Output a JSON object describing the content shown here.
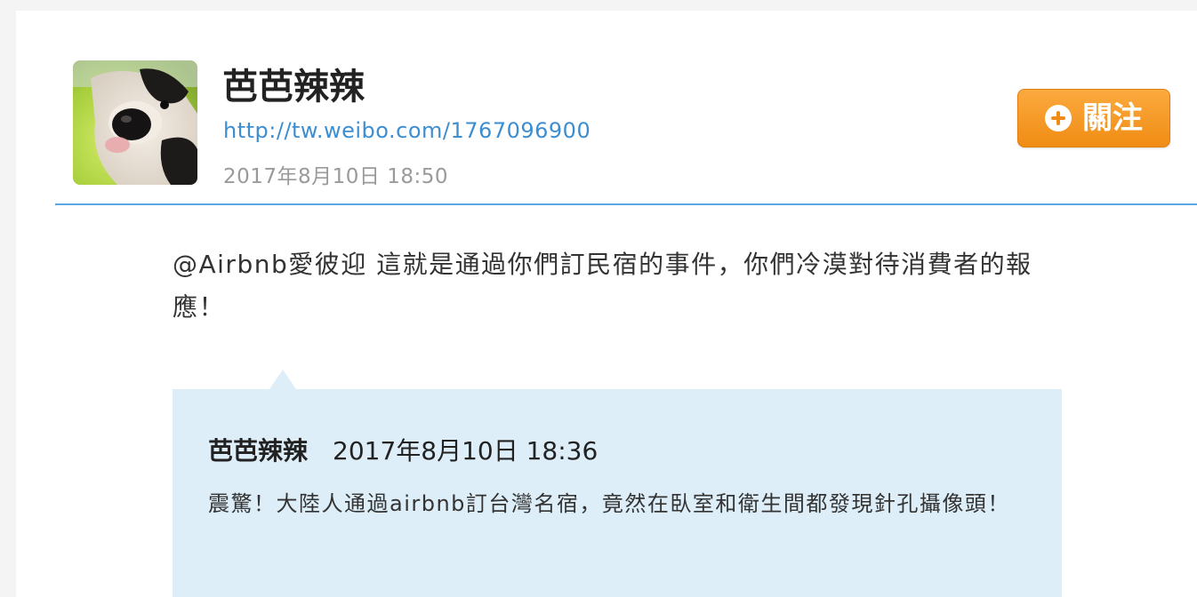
{
  "post": {
    "author": "芭芭辣辣",
    "profile_url": "http://tw.weibo.com/1767096900",
    "timestamp": "2017年8月10日 18:50",
    "text": "@Airbnb愛彼迎 這就是通過你們訂民宿的事件，你們冷漠對待消費者的報應！"
  },
  "follow_button": {
    "label": "關注",
    "icon": "plus-circle-icon"
  },
  "quoted_post": {
    "author": "芭芭辣辣",
    "timestamp": "2017年8月10日 18:36",
    "text": "震驚！大陸人通過airbnb訂台灣名宿，竟然在臥室和衛生間都發現針孔攝像頭！"
  },
  "colors": {
    "link": "#3d8ed1",
    "divider": "#5aa7e2",
    "follow_button": "#f08c14",
    "quote_background": "#ddeef8"
  }
}
